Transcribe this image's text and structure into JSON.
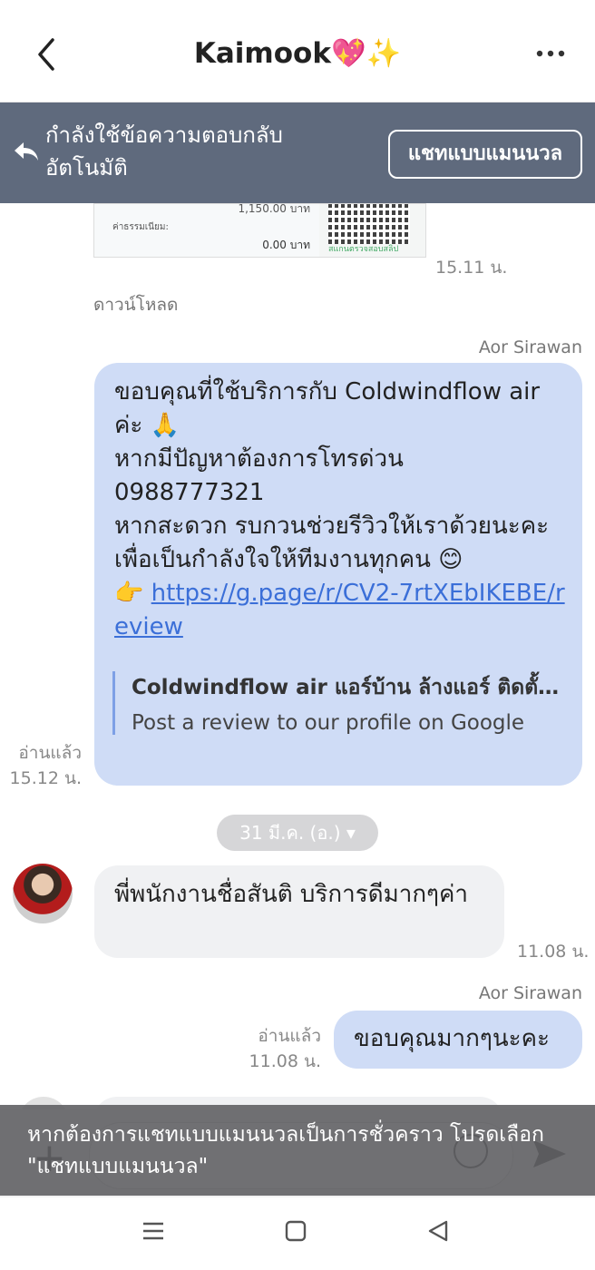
{
  "header": {
    "title": "Kaimook💖✨"
  },
  "banner": {
    "text": "กำลังใช้ข้อความตอบกลับอัตโนมัติ",
    "manual_button": "แชทแบบแมนนวล"
  },
  "image_message": {
    "amount": "1,150.00 บาท",
    "fee_label": "ค่าธรรมเนียม:",
    "fee": "0.00 บาท",
    "qr_caption": "สแกนตรวจสอบสลิป",
    "time": "15.11 น.",
    "download": "ดาวน์โหลด"
  },
  "message1": {
    "sender": "Aor Sirawan",
    "line1": "ขอบคุณที่ใช้บริการกับ Coldwindflow air ค่ะ 🙏",
    "line2": "หากมีปัญหาต้องการโทรด่วน",
    "line3": " 0988777321",
    "line4": "หากสะดวก รบกวนช่วยรีวิวให้เราด้วยนะคะ เพื่อเป็นกำลังใจให้ทีมงานทุกคน 😊",
    "pointer": "👉 ",
    "link": "https://g.page/r/CV2-7rtXEbIKEBE/review",
    "preview_title": "Coldwindflow air แอร์บ้าน ล้างแอร์ ติดตั้ง…",
    "preview_desc": "Post a review to our profile on Google",
    "read": "อ่านแล้ว",
    "time": "15.12 น."
  },
  "date_pill": "31 มี.ค. (อ.) ▾",
  "message2": {
    "text": "พี่พนักงานชื่อสันติ บริการดีมากๆค่า",
    "time": "11.08 น."
  },
  "message3": {
    "sender": "Aor Sirawan",
    "text": "ขอบคุณมากๆนะคะ",
    "read": "อ่านแล้ว",
    "time": "11.08 น."
  },
  "toast": "หากต้องการแชทแบบแมนนวลเป็นการชั่วคราว โปรดเลือก \"แชทแบบแมนนวล\"",
  "colors": {
    "banner": "#5f6a7d",
    "outgoing_bubble": "#cfdcf6",
    "incoming_bubble": "#f0f1f3",
    "link": "#3b6fd8"
  }
}
